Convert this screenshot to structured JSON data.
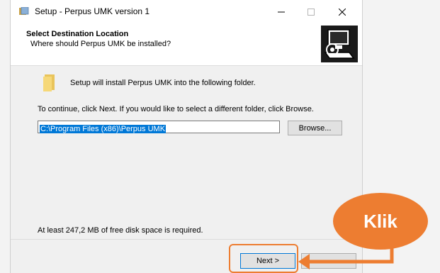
{
  "window": {
    "title": "Setup - Perpus UMK version 1",
    "controls": {
      "minimize": "minimize-icon",
      "maximize": "maximize-icon",
      "close": "close-icon"
    }
  },
  "header": {
    "title": "Select Destination Location",
    "subtitle": "Where should Perpus UMK be installed?",
    "icon": "computer-install-icon"
  },
  "body": {
    "folder_icon": "folder-icon",
    "intro": "Setup will install Perpus UMK into the following folder.",
    "instruction": "To continue, click Next. If you would like to select a different folder, click Browse.",
    "path_value": "C:\\Program Files (x86)\\Perpus UMK",
    "browse_label": "Browse...",
    "space_required": "At least 247,2 MB of free disk space is required."
  },
  "footer": {
    "next_label": "Next >"
  },
  "annotation": {
    "label": "Klik",
    "color": "#ed7d31"
  }
}
